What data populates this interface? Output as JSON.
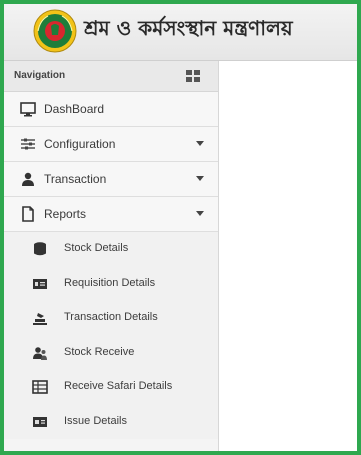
{
  "header": {
    "title": "শ্রম ও কর্মসংস্থান মন্ত্রণালয়",
    "logo_icon": "bangladesh-govt-logo"
  },
  "sidebar": {
    "title": "Navigation",
    "items": [
      {
        "label": "DashBoard",
        "icon": "monitor-icon",
        "expandable": false
      },
      {
        "label": "Configuration",
        "icon": "sliders-icon",
        "expandable": true
      },
      {
        "label": "Transaction",
        "icon": "user-icon",
        "expandable": true
      },
      {
        "label": "Reports",
        "icon": "document-icon",
        "expandable": true,
        "expanded": true
      }
    ],
    "report_subitems": [
      {
        "label": "Stock Details",
        "icon": "database-icon"
      },
      {
        "label": "Requisition Details",
        "icon": "id-card-icon"
      },
      {
        "label": "Transaction Details",
        "icon": "stack-icon"
      },
      {
        "label": "Stock Receive",
        "icon": "users-icon"
      },
      {
        "label": "Receive Safari Details",
        "icon": "grid-icon"
      },
      {
        "label": "Issue Details",
        "icon": "card-icon"
      }
    ]
  },
  "colors": {
    "frame_border": "#2fa84f",
    "logo_green": "#1e7d3a",
    "logo_red": "#d8272e",
    "logo_yellow": "#f2c318"
  }
}
